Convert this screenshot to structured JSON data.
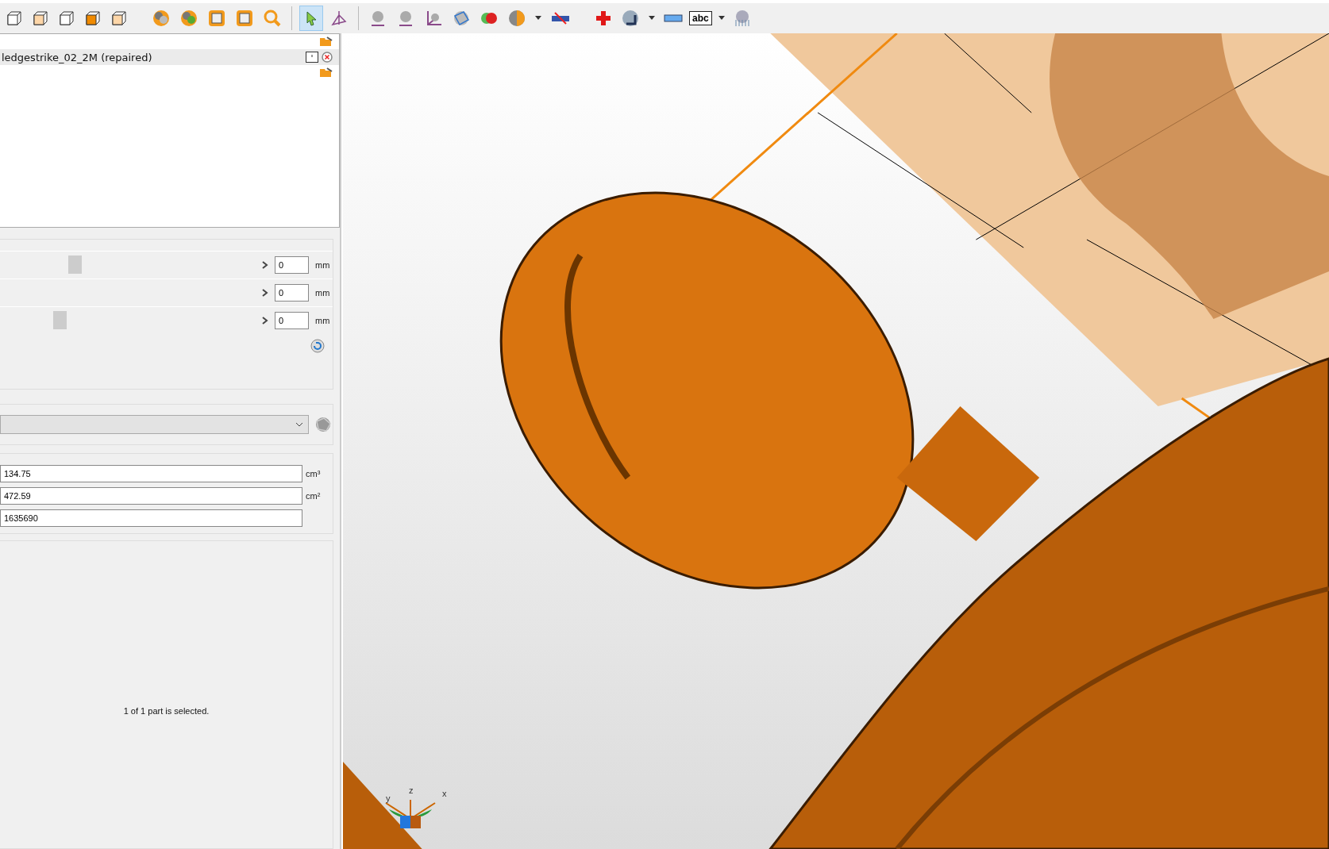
{
  "toolbar": {
    "text_button": "abc"
  },
  "objects": {
    "items": [
      {
        "name": "ledgestrike_02_2M (repaired)",
        "selected": true
      }
    ]
  },
  "offsets": [
    {
      "level": 0.27,
      "value": "0",
      "unit": "mm"
    },
    {
      "value": "0",
      "unit": "mm"
    },
    {
      "level": 0.21,
      "value": "0",
      "unit": "mm"
    }
  ],
  "properties": [
    {
      "value": "134.75",
      "unit": "cm³"
    },
    {
      "value": "472.59",
      "unit": "cm²"
    },
    {
      "value": "1635690"
    }
  ],
  "status": "1 of 1 part is selected.",
  "axes": {
    "y": "y",
    "z": "z",
    "x": "x"
  }
}
